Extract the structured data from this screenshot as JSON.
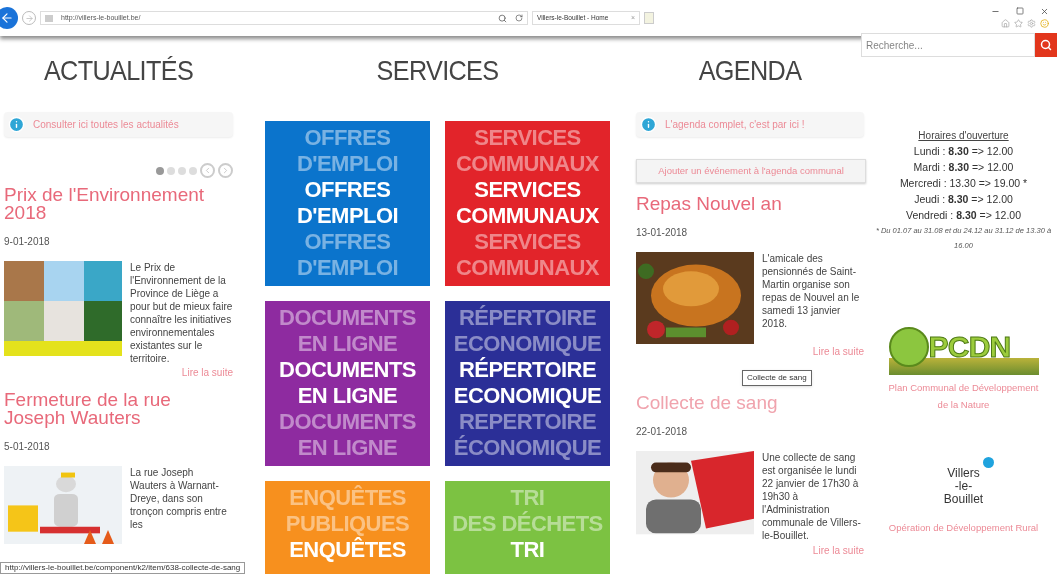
{
  "browser": {
    "address": "http://villers-le-bouillet.be/",
    "tab": {
      "title": "Villers-le-Bouillet - Home",
      "close": "×"
    },
    "status_url": "http://villers-le-bouillet.be/component/k2/item/638-collecte-de-sang"
  },
  "search": {
    "placeholder": "Recherche..."
  },
  "news": {
    "heading": "ACTUALITÉS",
    "info_link": "Consulter ici toutes les actualités",
    "carousel": [
      {
        "selected": true
      },
      {
        "selected": false
      },
      {
        "selected": false
      },
      {
        "selected": false
      }
    ],
    "articles": [
      {
        "title": "Prix de l'Environnement 2018",
        "date": "9-01-2018",
        "body": "Le Prix de l'Environnement de la Province de Liège a pour but de mieux faire connaître les initiatives environnementales existantes sur le territoire.",
        "more": "Lire la suite"
      },
      {
        "title": "Fermeture de la rue Joseph Wauters",
        "date": "5-01-2018",
        "body": "La rue Joseph Wauters à Warnant-Dreye, dans son tronçon compris entre les"
      }
    ]
  },
  "services": {
    "heading": "SERVICES",
    "tiles": [
      {
        "lines": [
          "OFFRES",
          "D'EMPLOI"
        ],
        "echo_top": [
          "OFFRES",
          "D'EMPLOI"
        ],
        "echo_bottom": [
          "OFFRES",
          "D'EMPLOI"
        ],
        "color": "#0b74cc"
      },
      {
        "lines": [
          "SERVICES",
          "COMMUNAUX"
        ],
        "echo_top": [
          "SERVICES",
          "COMMUNAUX"
        ],
        "echo_bottom": [
          "SERVICES",
          "COMMUNAUX"
        ],
        "color": "#e2242a"
      },
      {
        "lines": [
          "DOCUMENTS",
          "EN LIGNE"
        ],
        "echo_top": [
          "DOCUMENTS",
          "EN LIGNE"
        ],
        "echo_bottom": [
          "DOCUMENTS",
          "EN LIGNE"
        ],
        "color": "#8e2ba0"
      },
      {
        "lines": [
          "RÉPERTOIRE",
          "ECONOMIQUE"
        ],
        "echo_top": [
          "RÉPERTOIRE",
          "ECONOMIQUE"
        ],
        "echo_bottom": [
          "REPERTOIRE",
          "ÉCONOMIQUE"
        ],
        "color": "#2b2f97"
      },
      {
        "lines": [
          "ENQUÊTES"
        ],
        "echo_top": [
          "ENQUÊTES",
          "PUBLIQUES"
        ],
        "color": "#f7901e"
      },
      {
        "lines": [
          "TRI"
        ],
        "echo_top": [
          "TRI",
          "DES DÉCHETS"
        ],
        "color": "#7cc242"
      }
    ]
  },
  "agenda": {
    "heading": "AGENDA",
    "info_link": "L'agenda complet, c'est par ici !",
    "add_button": "Ajouter un événement à l'agenda communal",
    "articles": [
      {
        "title": "Repas Nouvel an",
        "hovered": false,
        "date": "13-01-2018",
        "body": "L'amicale des pensionnés de Saint-Martin organise son repas de Nouvel an le samedi 13 janvier 2018.",
        "more": "Lire la suite"
      },
      {
        "title": "Collecte de sang",
        "hovered": true,
        "date": "22-01-2018",
        "body": "Une collecte de sang est organisée le lundi 22 janvier de 17h30 à 19h30 à l'Administration communale de Villers-le-Bouillet.",
        "more": "Lire la suite"
      }
    ],
    "tooltip": "Collecte de sang"
  },
  "hours": {
    "title": "Horaires d'ouverture",
    "rows": [
      "Lundi : **8.30** => 12.00",
      "Mardi : **8.30** => 12.00",
      "Mercredi : 13.30 => 19.00 *",
      "Jeudi : **8.30** => 12.00",
      "Vendredi : **8.30** => 12.00"
    ],
    "note": "* Du 01.07 au 31.08 et du 24.12 au 31.12 de 13.30 à 16.00"
  },
  "partners": [
    {
      "kind": "pcdn",
      "logo_lines": [
        "PCDN"
      ],
      "caption": "Plan Communal de Développement de la Nature"
    },
    {
      "kind": "odr",
      "logo_lines": [
        "Villers",
        "-le-",
        "Bouillet"
      ],
      "caption": "Opération de Développement Rural"
    }
  ]
}
